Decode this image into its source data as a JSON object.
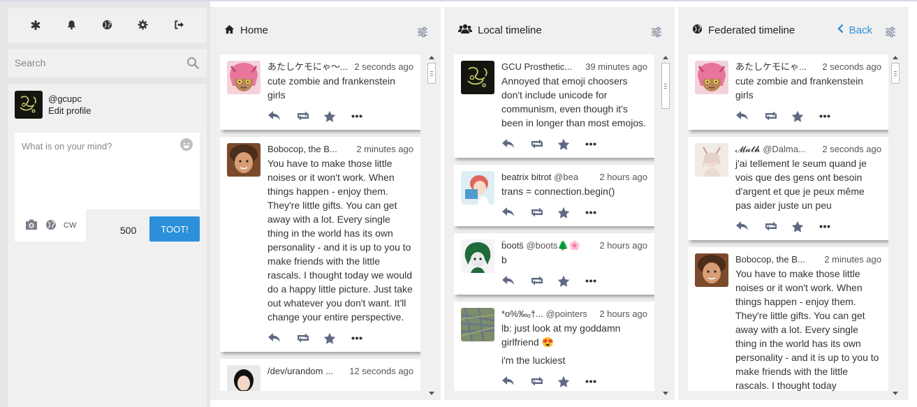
{
  "search": {
    "placeholder": "Search"
  },
  "profile": {
    "handle": "@gcupc",
    "edit_label": "Edit profile"
  },
  "compose": {
    "placeholder": "What is on your mind?",
    "cw_label": "CW",
    "counter": "500",
    "toot_label": "TOOT!"
  },
  "columns": {
    "home": {
      "title": "Home",
      "statuses": [
        {
          "name": "あたしケモにゃ～...",
          "handle": "",
          "time": "2 seconds ago",
          "text": [
            "cute zombie and frankenstein girls"
          ]
        },
        {
          "name": "Bobocop, the B...",
          "handle": "",
          "time": "2 minutes ago",
          "text": [
            "You have to make those little noises or it won't work. When things happen - enjoy them. They're little gifts. You can get away with a lot. Every single thing in the world has its own personality - and it is up to you to make friends with the little rascals. I thought today we would do a happy little picture. Just take out whatever you don't want. It'll change your entire perspective."
          ]
        },
        {
          "name": "/dev/urandom ...",
          "handle": "",
          "time": "12 seconds ago",
          "text": []
        }
      ]
    },
    "local": {
      "title": "Local timeline",
      "statuses": [
        {
          "name": "GCU Prosthetic...",
          "handle": "",
          "time": "39 minutes ago",
          "text": [
            "Annoyed that emoji choosers don't include unicode for communism, even though it's been in longer than most emojos."
          ]
        },
        {
          "name": "beatrix bitrot",
          "handle": "@bea",
          "time": "2 hours ago",
          "text": [
            "trans = connection.begin()"
          ]
        },
        {
          "name": "b̈oots̈",
          "handle": "@boots🌲🌸",
          "time": "2 hours ago",
          "text": [
            "b"
          ]
        },
        {
          "name": "*o%‰ₒ†...",
          "handle": "@pointers",
          "time": "2 hours ago",
          "text": [
            "lb: just look at my goddamn girlfriend 😍",
            "i'm the luckiest"
          ]
        }
      ]
    },
    "federated": {
      "title": "Federated timeline",
      "back_label": "Back",
      "statuses": [
        {
          "name": "あたしケモにゃ...",
          "handle": "",
          "time": "2 seconds ago",
          "text": [
            "cute zombie and frankenstein girls"
          ]
        },
        {
          "name": "𝓜𝓪𝓽𝓱",
          "handle": "@Dalma...",
          "time": "2 seconds ago",
          "text": [
            "j'ai tellement le seum quand je vois que des gens ont besoin d'argent et que je peux même pas aider juste un peu"
          ]
        },
        {
          "name": "Bobocop, the B...",
          "handle": "",
          "time": "2 minutes ago",
          "text": [
            "You have to make those little noises or it won't work. When things happen - enjoy them. They're little gifts. You can get away with a lot. Every single thing in the world has its own personality - and it is up to you to make friends with the little rascals. I thought today"
          ]
        }
      ]
    }
  },
  "colors": {
    "accent": "#2b90d9",
    "background": "#e6e6e6",
    "column": "#f0f0f0",
    "icon": "#606984"
  },
  "icons": {
    "nav": [
      "asterisk-icon",
      "bell-icon",
      "globe-icon",
      "cog-icon",
      "sign-out-icon"
    ],
    "status_actions": [
      "reply-icon",
      "boost-icon",
      "favourite-icon",
      "more-icon"
    ]
  }
}
